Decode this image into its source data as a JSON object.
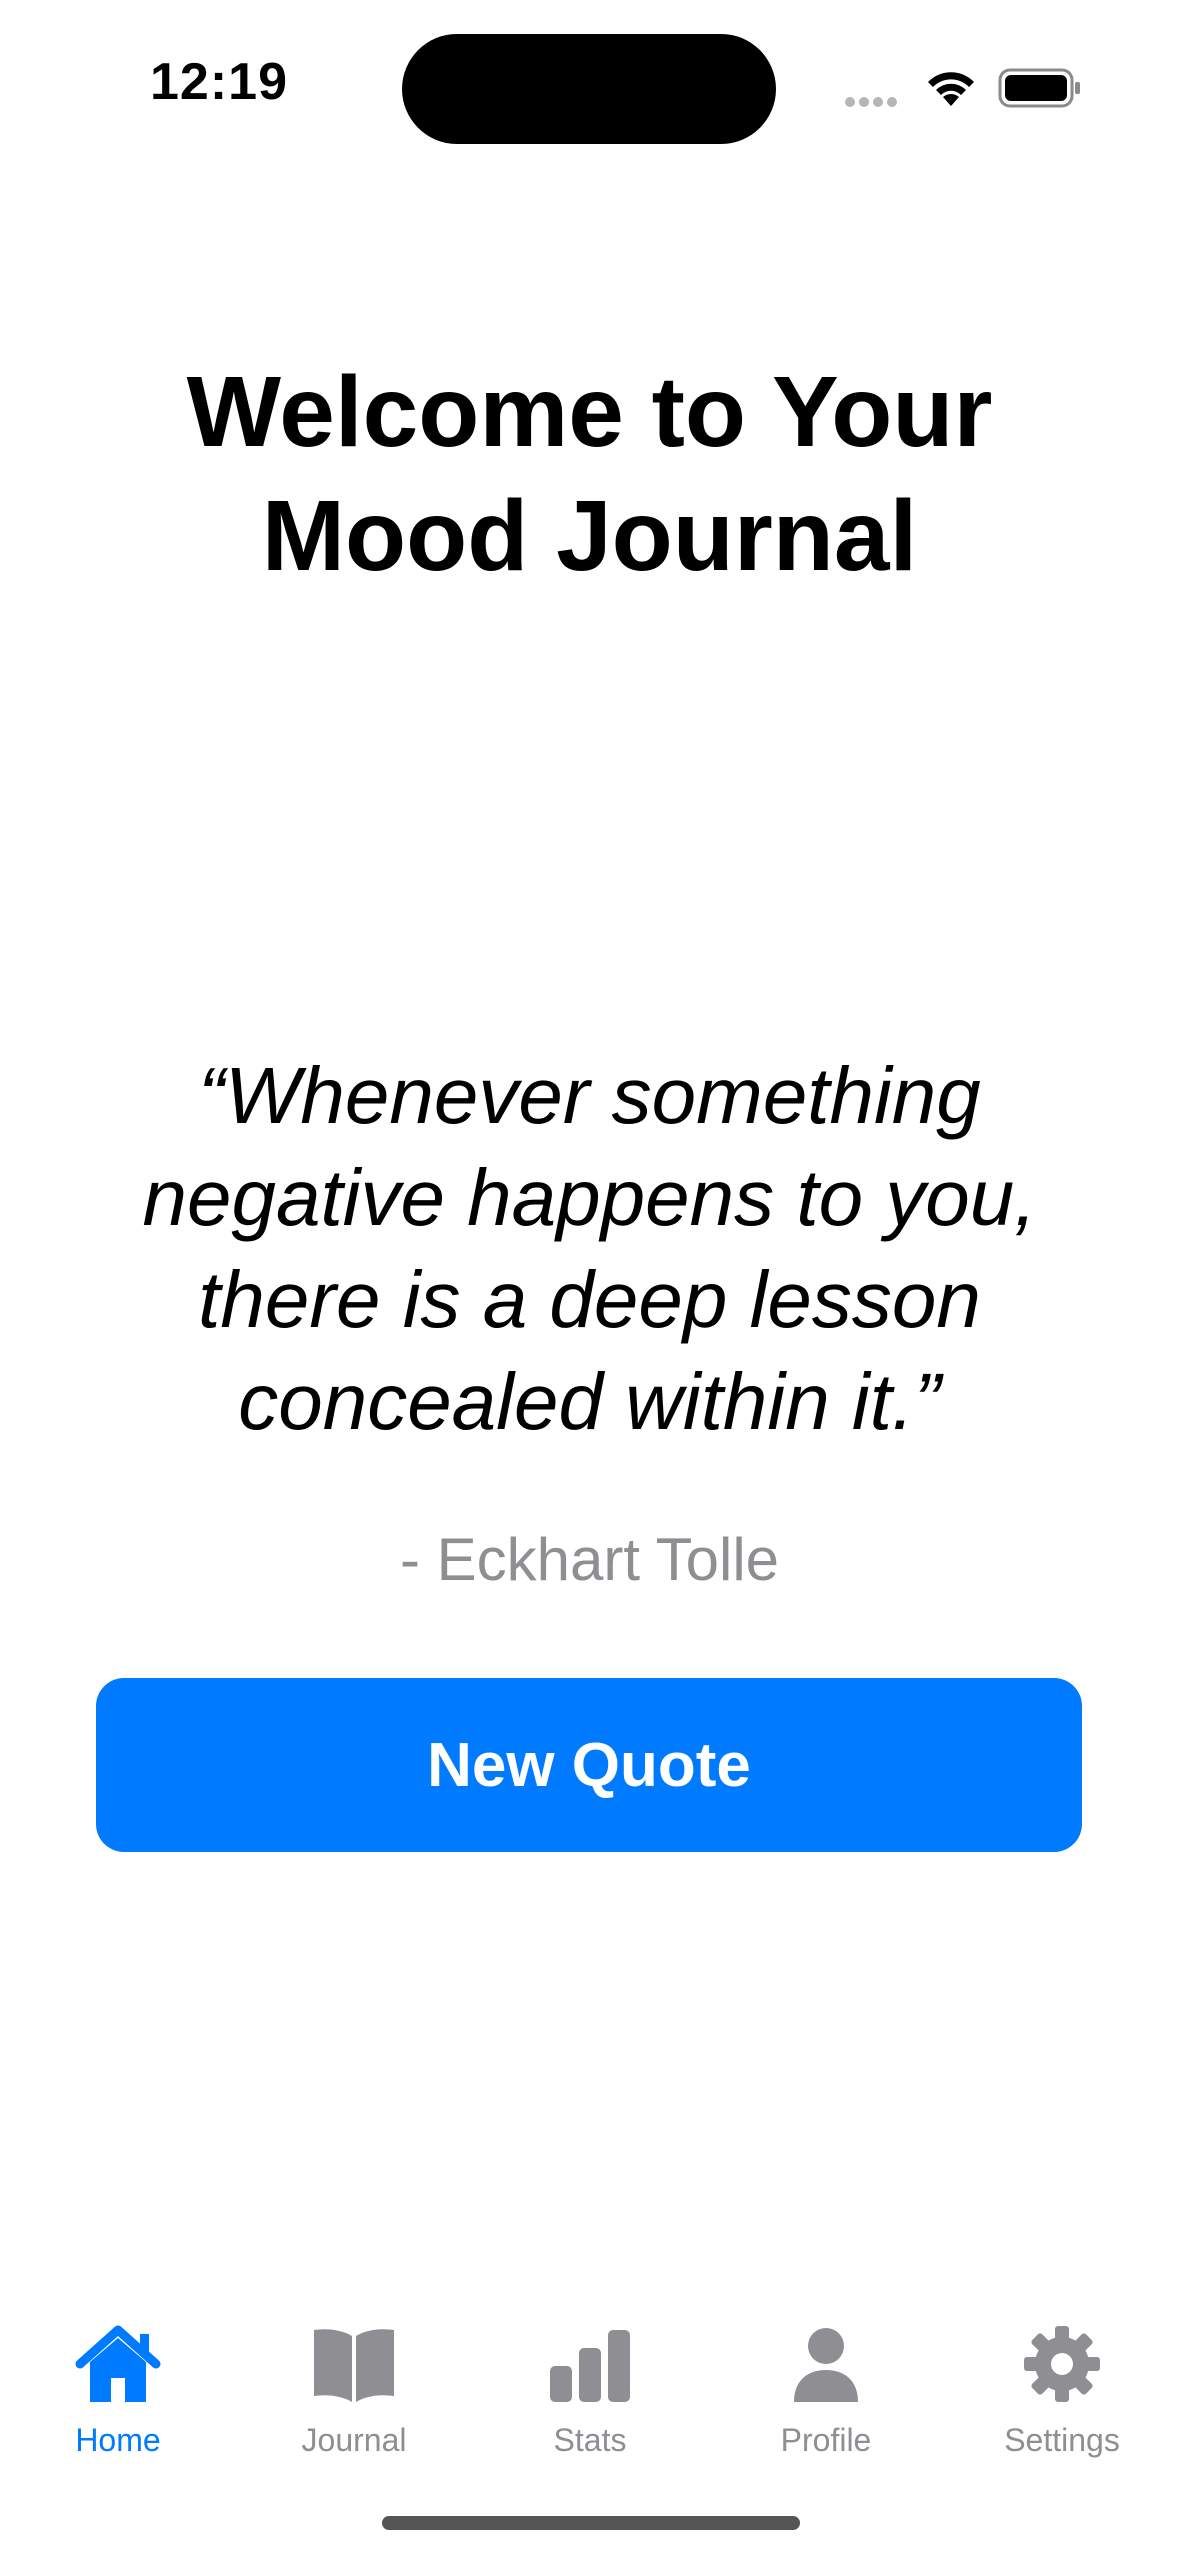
{
  "status_bar": {
    "time": "12:19"
  },
  "header": {
    "title_line1": "Welcome to Your",
    "title_line2": "Mood Journal"
  },
  "quote": {
    "line1": "“Whenever something",
    "line2": "negative happens to you,",
    "line3": "there is a deep lesson",
    "line4": "concealed within it.”",
    "author": "- Eckhart Tolle"
  },
  "actions": {
    "new_quote_label": "New Quote"
  },
  "tabbar": {
    "items": [
      {
        "label": "Home",
        "icon": "house-icon",
        "active": true
      },
      {
        "label": "Journal",
        "icon": "book-icon",
        "active": false
      },
      {
        "label": "Stats",
        "icon": "bar-chart-icon",
        "active": false
      },
      {
        "label": "Profile",
        "icon": "person-icon",
        "active": false
      },
      {
        "label": "Settings",
        "icon": "gear-icon",
        "active": false
      }
    ]
  },
  "colors": {
    "accent": "#007aff",
    "inactive": "#8e8e93"
  }
}
